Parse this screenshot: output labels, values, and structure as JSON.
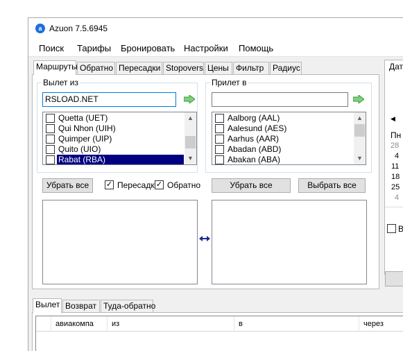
{
  "window": {
    "title": "Azuon 7.5.6945",
    "icon": "azuon-logo-icon"
  },
  "menu": [
    "Поиск",
    "Тарифы",
    "Бронировать",
    "Настройки",
    "Помощь"
  ],
  "tabs": [
    "Маршруты",
    "Обратно",
    "Пересадки",
    "Stopovers",
    "Цены",
    "Фильтр",
    "Радиус"
  ],
  "active_tab": "Маршруты",
  "departure": {
    "group_label": "Вылет из",
    "search_value": "RSLOAD.NET",
    "items": [
      "Quetta (UET)",
      "Qui Nhon (UIH)",
      "Quimper (UIP)",
      "Quito (UIO)",
      "Rabat (RBA)"
    ],
    "selected_item": "Rabat (RBA)",
    "clear_button": "Убрать все"
  },
  "arrival": {
    "group_label": "Прилет в",
    "search_value": "",
    "items": [
      "Aalborg (AAL)",
      "Aalesund (AES)",
      "Aarhus (AAR)",
      "Abadan (ABD)",
      "Abakan (ABA)"
    ],
    "clear_button": "Убрать все",
    "select_all_button": "Выбрать все"
  },
  "options": {
    "transfers_label": "Пересадки",
    "transfers_checked": true,
    "return_label": "Обратно",
    "return_checked": true
  },
  "side_panel": {
    "tab_label": "Дат",
    "weekday_label": "Пн",
    "dates": [
      "28",
      "4",
      "11",
      "18",
      "25",
      "4"
    ],
    "checkbox_label": "Вы"
  },
  "results": {
    "tabs": [
      "Вылет",
      "Возврат",
      "Туда-обратно"
    ],
    "active_tab": "Вылет",
    "columns": [
      "авиакомпа",
      "из",
      "в",
      "через"
    ]
  }
}
